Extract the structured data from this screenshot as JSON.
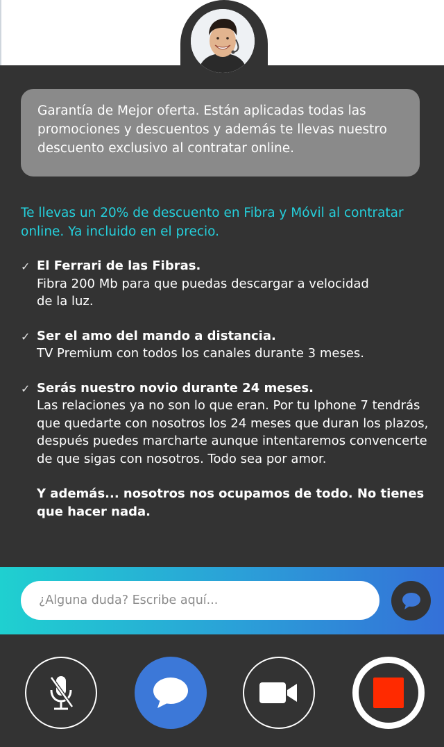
{
  "agent": {
    "avatar_icon": "agent-avatar-icon"
  },
  "bubble": {
    "text": "Garantía de Mejor oferta. Están aplicadas todas las promociones y descuentos y además te llevas nuestro descuento exclusivo al contratar online."
  },
  "promo": {
    "text": "Te llevas un 20% de descuento en Fibra y Móvil al contratar online. Ya incluido en el precio.",
    "color": "#25d0dc"
  },
  "features": [
    {
      "check": "✓",
      "title": "El Ferrari de las Fibras.",
      "desc": "Fibra 200 Mb para que puedas descargar  a velocidad de la luz."
    },
    {
      "check": "✓",
      "title": "Ser el amo del mando a distancia.",
      "desc": "TV Premium con todos los canales durante 3 meses."
    },
    {
      "check": "✓",
      "title": "Serás nuestro novio durante 24 meses.",
      "desc": "Las relaciones ya no son lo que eran. Por tu Iphone 7 tendrás que quedarte con nosotros los 24 meses que duran los plazos, después puedes marcharte aunque intentaremos convencerte de que sigas con nosotros. Todo sea por amor."
    }
  ],
  "extra": {
    "text": "Y además... nosotros nos ocupamos de todo. No tienes que hacer nada."
  },
  "chat_input": {
    "placeholder": "¿Alguna duda? Escribe aquí...",
    "value": ""
  },
  "controls": {
    "mic_icon": "mic-muted-icon",
    "chat_icon": "chat-bubble-icon",
    "video_icon": "video-camera-icon",
    "end_icon": "stop-icon",
    "accent": "#3c78d8",
    "stop_color": "#ff2a00"
  }
}
